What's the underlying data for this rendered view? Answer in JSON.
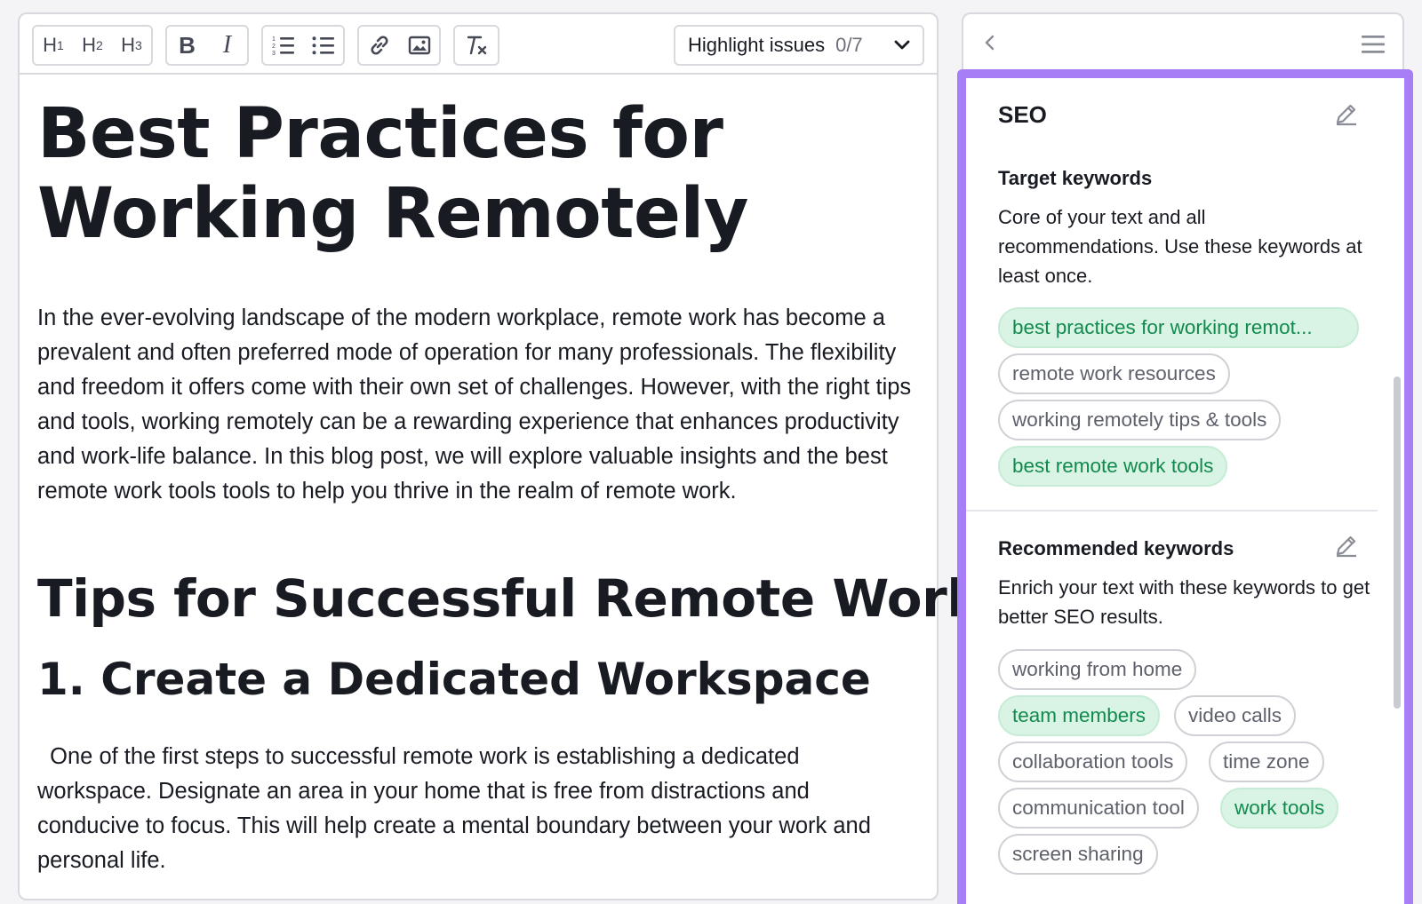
{
  "toolbar": {
    "headings": [
      "H",
      "H",
      "H"
    ],
    "heading_levels": [
      "1",
      "2",
      "3"
    ],
    "bold": "B",
    "italic": "I",
    "highlight_label": "Highlight issues",
    "highlight_count": "0/7"
  },
  "document": {
    "title": "Best Practices for Working Remotely",
    "intro": "In the ever-evolving landscape of the modern workplace, remote work has become a prevalent and often preferred mode of operation for many professionals. The flexibility and freedom it offers come with their own set of challenges. However, with the right tips and tools, working remotely can be a rewarding experience that enhances productivity and work-life balance. In this blog post, we will explore valuable insights and the best remote work tools tools to help you thrive in the realm of remote work.",
    "h2": "Tips for Successful Remote Work",
    "h3": "1. Create a Dedicated Workspace",
    "p2": "  One of the first steps to successful remote work is establishing a dedicated workspace. Designate an area in your home that is free from distractions and conducive to focus. This will help create a mental boundary between your work and personal life."
  },
  "seo": {
    "title": "SEO",
    "target": {
      "title": "Target keywords",
      "description": "Core of your text and all recommendations. Use these keywords at least once.",
      "keywords": [
        {
          "label": "best practices for working remot...",
          "used": true
        },
        {
          "label": "remote work resources",
          "used": false
        },
        {
          "label": "working remotely tips & tools",
          "used": false
        },
        {
          "label": "best remote work tools",
          "used": true
        }
      ]
    },
    "recommended": {
      "title": "Recommended keywords",
      "description": "Enrich your text with these keywords to get better SEO results.",
      "keywords": [
        {
          "label": "working from home",
          "used": false
        },
        {
          "label": "team members",
          "used": true
        },
        {
          "label": "video calls",
          "used": false
        },
        {
          "label": "collaboration tools",
          "used": false
        },
        {
          "label": "time zone",
          "used": false
        },
        {
          "label": "communication tool",
          "used": false
        },
        {
          "label": "work tools",
          "used": true
        },
        {
          "label": "screen sharing",
          "used": false
        }
      ]
    }
  },
  "colors": {
    "accent_frame": "#a77ef5",
    "keyword_used_bg": "#d9f4e4",
    "keyword_used_text": "#128a4f"
  }
}
